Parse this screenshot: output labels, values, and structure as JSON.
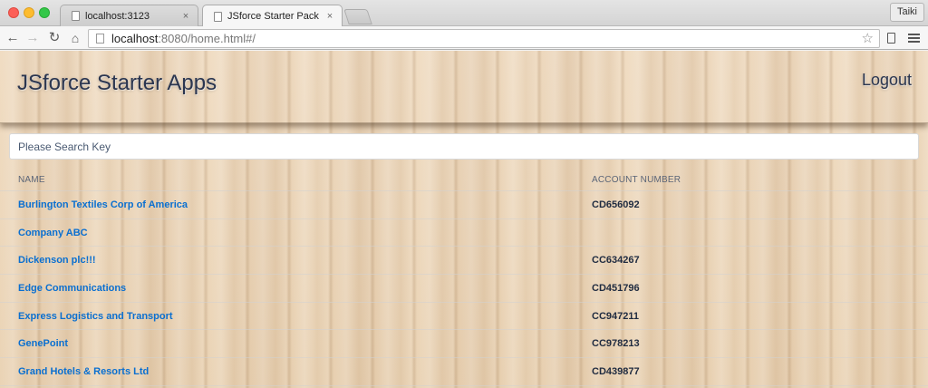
{
  "browser": {
    "tabs": [
      {
        "label": "localhost:3123",
        "close": "×"
      },
      {
        "label": "JSforce Starter Pack",
        "close": "×"
      }
    ],
    "profile_name": "Taiki",
    "url_host": "localhost",
    "url_rest": ":8080/home.html#/"
  },
  "header": {
    "title": "JSforce Starter Apps",
    "logout_label": "Logout"
  },
  "search": {
    "placeholder": "Please Search Key"
  },
  "table": {
    "columns": [
      "NAME",
      "ACCOUNT NUMBER"
    ],
    "rows": [
      {
        "name": "Burlington Textiles Corp of America",
        "account": "CD656092"
      },
      {
        "name": "Company ABC",
        "account": ""
      },
      {
        "name": "Dickenson plc!!!",
        "account": "CC634267"
      },
      {
        "name": "Edge Communications",
        "account": "CD451796"
      },
      {
        "name": "Express Logistics and Transport",
        "account": "CC947211"
      },
      {
        "name": "GenePoint",
        "account": "CC978213"
      },
      {
        "name": "Grand Hotels & Resorts Ltd",
        "account": "CD439877"
      }
    ]
  },
  "colors": {
    "link": "#0a6fd0",
    "title": "#2b3650"
  }
}
